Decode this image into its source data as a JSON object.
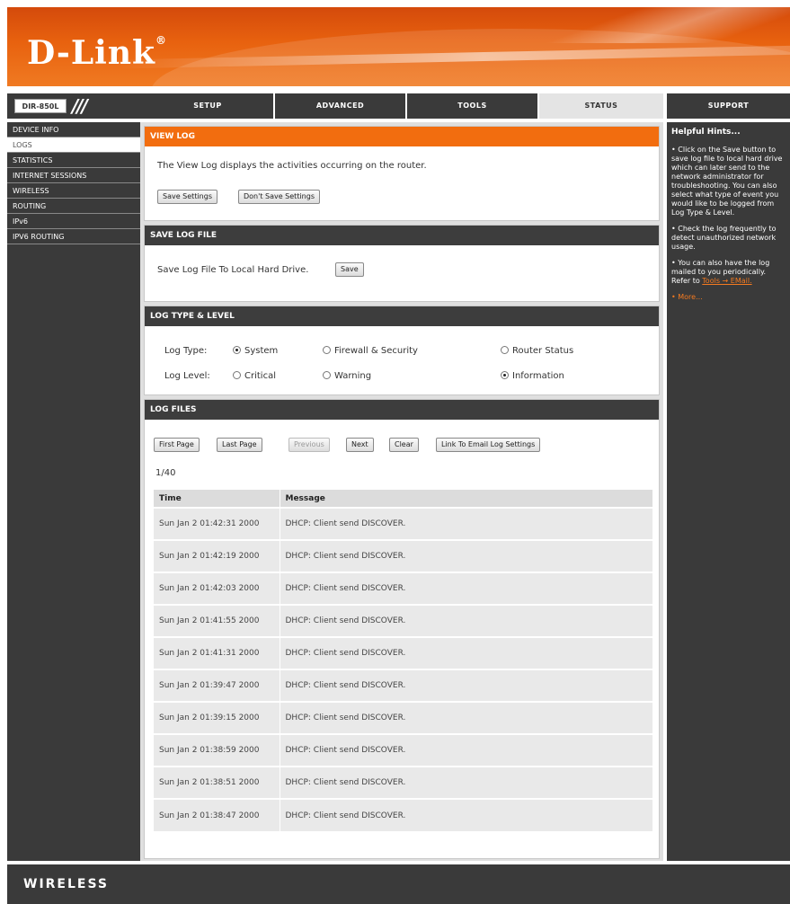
{
  "brand": {
    "logo": "D-Link",
    "trademark": "®",
    "footer": "WIRELESS"
  },
  "model": "DIR-850L",
  "nav": {
    "tabs": [
      "SETUP",
      "ADVANCED",
      "TOOLS",
      "STATUS",
      "SUPPORT"
    ],
    "active": "STATUS"
  },
  "sidebar": {
    "items": [
      "DEVICE INFO",
      "LOGS",
      "STATISTICS",
      "INTERNET SESSIONS",
      "WIRELESS",
      "ROUTING",
      "IPv6",
      "IPV6 ROUTING"
    ],
    "active": "LOGS"
  },
  "view_log": {
    "title": "VIEW LOG",
    "description": "The View Log displays the activities occurring on the router.",
    "save_button": "Save Settings",
    "dont_save_button": "Don't Save Settings"
  },
  "save_log": {
    "title": "SAVE LOG FILE",
    "label": "Save Log File To Local Hard Drive.",
    "button": "Save"
  },
  "log_type": {
    "title": "LOG TYPE & LEVEL",
    "type_label": "Log Type:",
    "types": [
      {
        "label": "System",
        "checked": true
      },
      {
        "label": "Firewall & Security",
        "checked": false
      },
      {
        "label": "Router Status",
        "checked": false
      }
    ],
    "level_label": "Log Level:",
    "levels": [
      {
        "label": "Critical",
        "checked": false
      },
      {
        "label": "Warning",
        "checked": false
      },
      {
        "label": "Information",
        "checked": true
      }
    ]
  },
  "log_files": {
    "title": "LOG FILES",
    "buttons": {
      "first": "First Page",
      "last": "Last Page",
      "previous": "Previous",
      "next": "Next",
      "clear": "Clear",
      "email": "Link To Email Log Settings"
    },
    "page": "1/40",
    "columns": [
      "Time",
      "Message"
    ],
    "rows": [
      {
        "time": "Sun Jan 2 01:42:31 2000",
        "message": "DHCP: Client send DISCOVER."
      },
      {
        "time": "Sun Jan 2 01:42:19 2000",
        "message": "DHCP: Client send DISCOVER."
      },
      {
        "time": "Sun Jan 2 01:42:03 2000",
        "message": "DHCP: Client send DISCOVER."
      },
      {
        "time": "Sun Jan 2 01:41:55 2000",
        "message": "DHCP: Client send DISCOVER."
      },
      {
        "time": "Sun Jan 2 01:41:31 2000",
        "message": "DHCP: Client send DISCOVER."
      },
      {
        "time": "Sun Jan 2 01:39:47 2000",
        "message": "DHCP: Client send DISCOVER."
      },
      {
        "time": "Sun Jan 2 01:39:15 2000",
        "message": "DHCP: Client send DISCOVER."
      },
      {
        "time": "Sun Jan 2 01:38:59 2000",
        "message": "DHCP: Client send DISCOVER."
      },
      {
        "time": "Sun Jan 2 01:38:51 2000",
        "message": "DHCP: Client send DISCOVER."
      },
      {
        "time": "Sun Jan 2 01:38:47 2000",
        "message": "DHCP: Client send DISCOVER."
      }
    ]
  },
  "hints": {
    "title": "Helpful Hints...",
    "items": [
      "• Click on the Save button to save log file to local hard drive which can later send to the network administrator for troubleshooting. You can also select what type of event you would like to be logged from Log Type & Level.",
      "• Check the log frequently to detect unauthorized network usage.",
      "• You can also have the log mailed to you periodically. Refer to"
    ],
    "link": "Tools → EMail.",
    "more": "• More..."
  },
  "colors": {
    "accent": "#f26d0f",
    "dark": "#3a3a3a"
  }
}
